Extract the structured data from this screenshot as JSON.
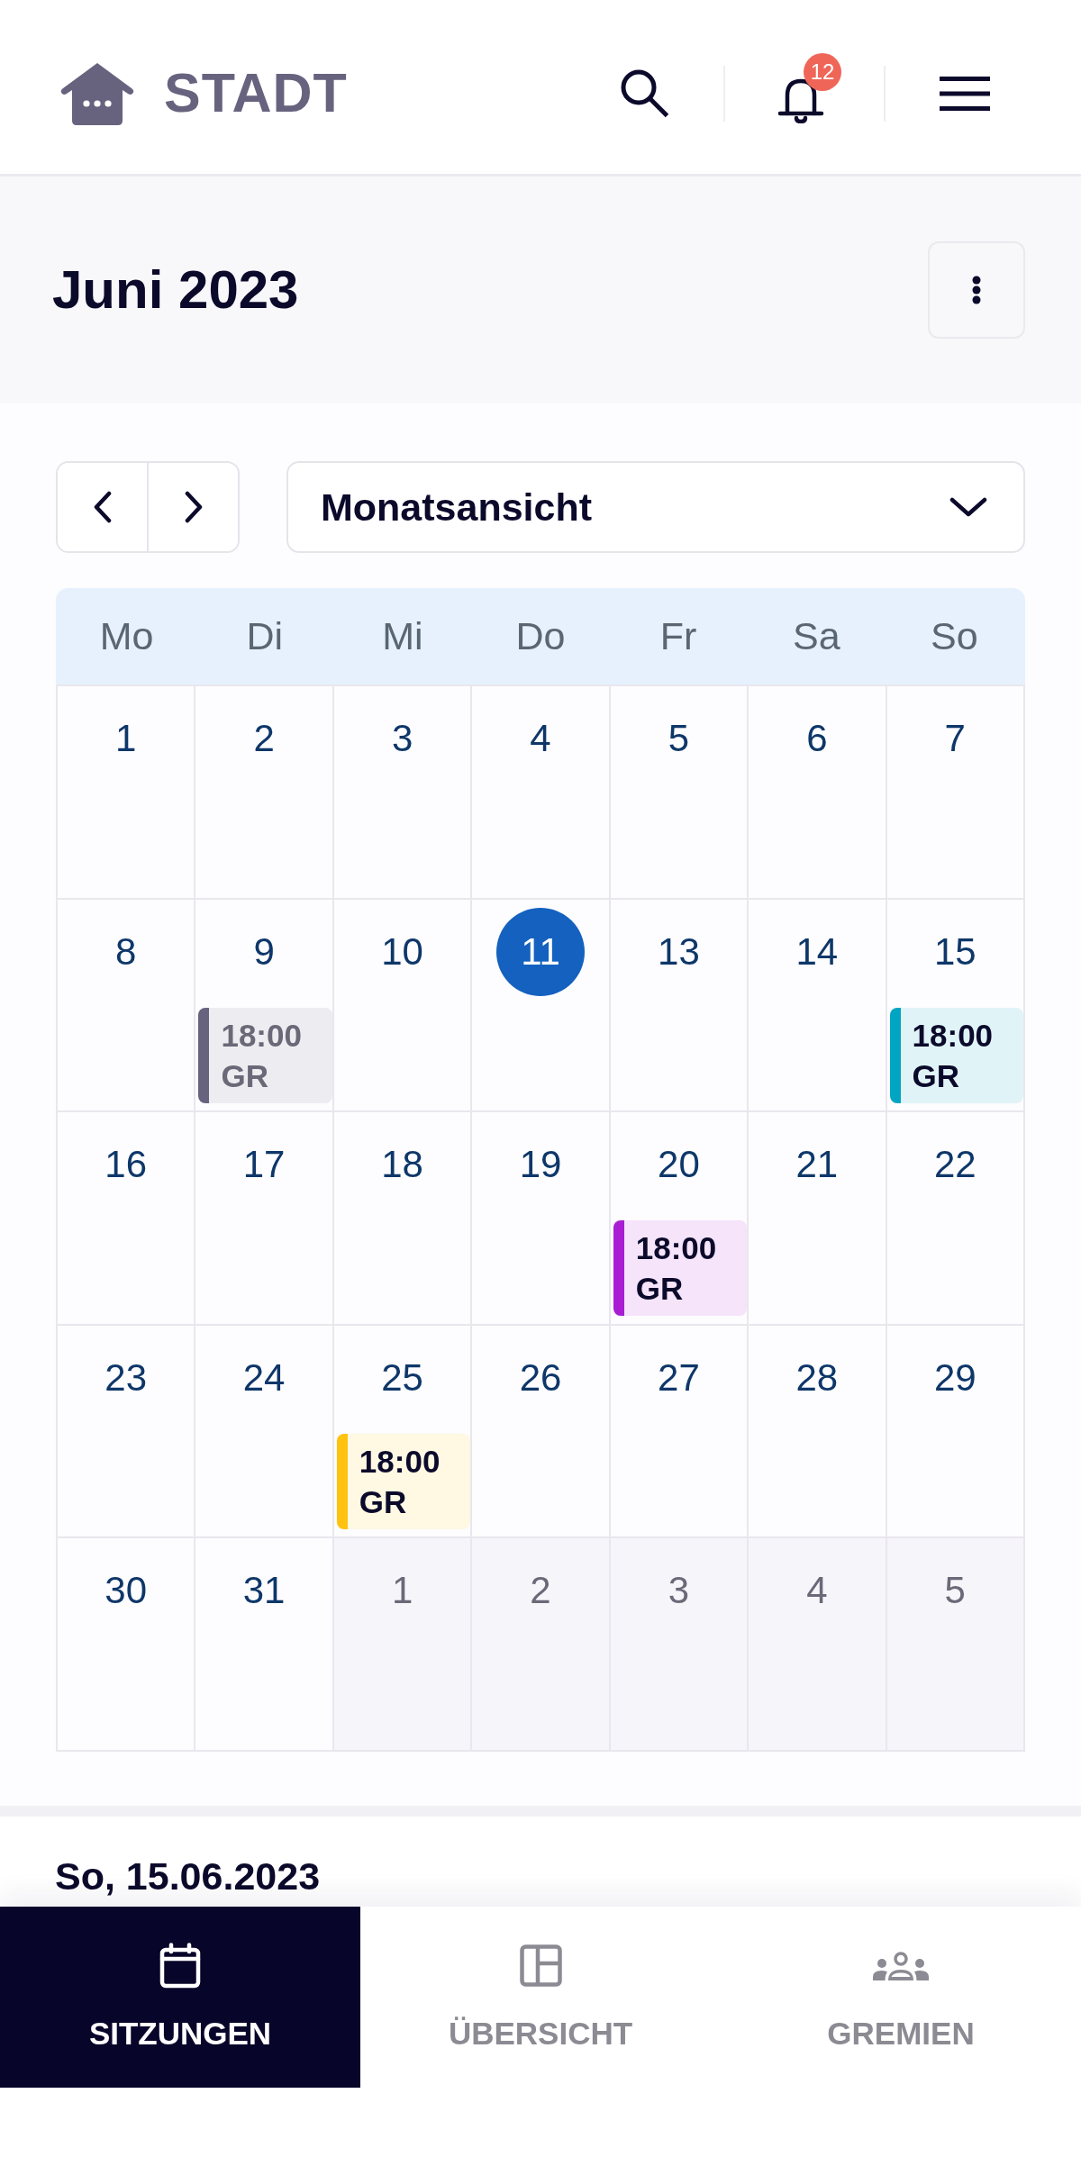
{
  "header": {
    "logo_text": "STADT",
    "notification_count": "12"
  },
  "title_bar": {
    "title": "Juni 2023"
  },
  "toolbar": {
    "view_select": {
      "value": "Monatsansicht"
    }
  },
  "calendar": {
    "weekdays": [
      "Mo",
      "Di",
      "Mi",
      "Do",
      "Fr",
      "Sa",
      "So"
    ],
    "weeks": [
      [
        {
          "day": "1",
          "selected": false,
          "outside_month": false
        },
        {
          "day": "2",
          "selected": false,
          "outside_month": false
        },
        {
          "day": "3",
          "selected": false,
          "outside_month": false
        },
        {
          "day": "4",
          "selected": false,
          "outside_month": false
        },
        {
          "day": "5",
          "selected": false,
          "outside_month": false
        },
        {
          "day": "6",
          "selected": false,
          "outside_month": false
        },
        {
          "day": "7",
          "selected": false,
          "outside_month": false
        }
      ],
      [
        {
          "day": "8",
          "selected": false,
          "outside_month": false
        },
        {
          "day": "9",
          "selected": false,
          "outside_month": false,
          "events": [
            {
              "time": "18:00",
              "label": "GR",
              "color": "#67637f",
              "dimmed": true
            }
          ]
        },
        {
          "day": "10",
          "selected": false,
          "outside_month": false
        },
        {
          "day": "11",
          "selected": true,
          "outside_month": false
        },
        {
          "day": "13",
          "selected": false,
          "outside_month": false
        },
        {
          "day": "14",
          "selected": false,
          "outside_month": false
        },
        {
          "day": "15",
          "selected": false,
          "outside_month": false,
          "events": [
            {
              "time": "18:00",
              "label": "GR",
              "color": "#00a5c4",
              "dimmed": false
            }
          ]
        }
      ],
      [
        {
          "day": "16",
          "selected": false,
          "outside_month": false
        },
        {
          "day": "17",
          "selected": false,
          "outside_month": false
        },
        {
          "day": "18",
          "selected": false,
          "outside_month": false
        },
        {
          "day": "19",
          "selected": false,
          "outside_month": false
        },
        {
          "day": "20",
          "selected": false,
          "outside_month": false,
          "events": [
            {
              "time": "18:00",
              "label": "GR",
              "color": "#a91ed3",
              "dimmed": false
            }
          ]
        },
        {
          "day": "21",
          "selected": false,
          "outside_month": false
        },
        {
          "day": "22",
          "selected": false,
          "outside_month": false
        }
      ],
      [
        {
          "day": "23",
          "selected": false,
          "outside_month": false
        },
        {
          "day": "24",
          "selected": false,
          "outside_month": false
        },
        {
          "day": "25",
          "selected": false,
          "outside_month": false,
          "events": [
            {
              "time": "18:00",
              "label": "GR",
              "color": "#ffc20e",
              "dimmed": false
            }
          ]
        },
        {
          "day": "26",
          "selected": false,
          "outside_month": false
        },
        {
          "day": "27",
          "selected": false,
          "outside_month": false
        },
        {
          "day": "28",
          "selected": false,
          "outside_month": false
        },
        {
          "day": "29",
          "selected": false,
          "outside_month": false
        }
      ],
      [
        {
          "day": "30",
          "selected": false,
          "outside_month": false
        },
        {
          "day": "31",
          "selected": false,
          "outside_month": false
        },
        {
          "day": "1",
          "selected": false,
          "outside_month": true
        },
        {
          "day": "2",
          "selected": false,
          "outside_month": true
        },
        {
          "day": "3",
          "selected": false,
          "outside_month": true
        },
        {
          "day": "4",
          "selected": false,
          "outside_month": true
        },
        {
          "day": "5",
          "selected": false,
          "outside_month": true
        }
      ]
    ]
  },
  "selected_date": {
    "heading": "So, 15.06.2023"
  },
  "bottom_nav": [
    {
      "label": "SITZUNGEN",
      "selected": true
    },
    {
      "label": "ÜBERSICHT",
      "selected": false
    },
    {
      "label": "GREMIEN",
      "selected": false
    }
  ]
}
